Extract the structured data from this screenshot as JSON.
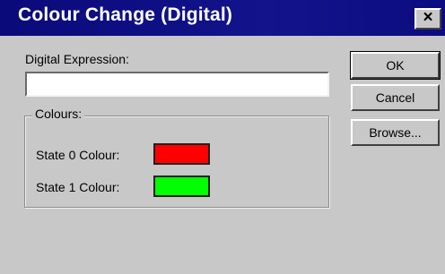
{
  "dialog": {
    "title": "Colour Change (Digital)",
    "close_glyph": "×"
  },
  "expression": {
    "label": "Digital Expression:",
    "value": ""
  },
  "colours": {
    "group_label": "Colours:",
    "state0_label": "State 0 Colour:",
    "state0_color": "#ff0000",
    "state1_label": "State 1 Colour:",
    "state1_color": "#00ff00"
  },
  "buttons": {
    "ok": "OK",
    "cancel": "Cancel",
    "browse": "Browse..."
  },
  "theme": {
    "titlebar": "#10108a",
    "dialog_bg": "#c8c8c8"
  }
}
